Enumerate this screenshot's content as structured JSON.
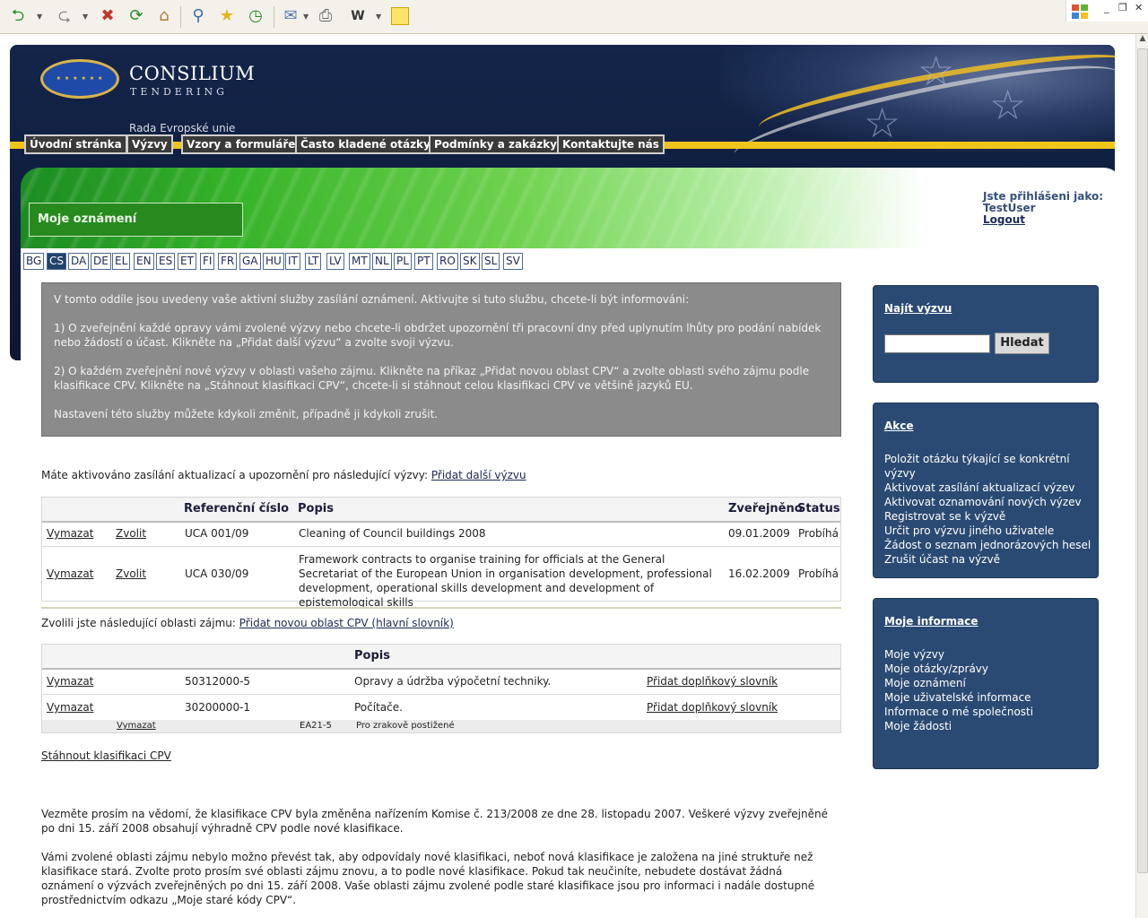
{
  "browser": {
    "toolbar_icons": [
      "back-icon",
      "forward-icon",
      "stop-icon",
      "refresh-icon",
      "home-icon",
      "search-icon",
      "favorites-icon",
      "history-icon",
      "mail-icon",
      "print-icon",
      "word-icon",
      "note-icon"
    ]
  },
  "header": {
    "brand_main": "CONSILIUM",
    "brand_sub": "TENDERING",
    "subtitle": "Rada Evropské unie",
    "nav": [
      "Úvodní stránka",
      "Výzvy",
      "Vzory a formuláře",
      "Často kladené otázky",
      "Podmínky a zakázky",
      "Kontaktujte nás"
    ]
  },
  "banner": {
    "section_title": "Moje oznámení"
  },
  "login": {
    "label": "Jste přihlášeni jako:",
    "user": "TestUser",
    "logout": "Logout"
  },
  "languages": [
    "BG",
    "CS",
    "DA",
    "DE",
    "EL",
    "EN",
    "ES",
    "ET",
    "FI",
    "FR",
    "GA",
    "HU",
    "IT",
    "LT",
    "LV",
    "MT",
    "NL",
    "PL",
    "PT",
    "RO",
    "SK",
    "SL",
    "SV"
  ],
  "active_language": "CS",
  "info": {
    "p1": "V tomto oddíle jsou uvedeny vaše aktivní služby zasílání oznámení. Aktivujte si tuto službu, chcete-li být informováni:",
    "p2": "1) O zveřejnění každé opravy vámi zvolené výzvy nebo chcete-li obdržet upozornění tři pracovní dny před uplynutím lhůty pro podání nabídek nebo žádostí o účast. Klikněte na „Přidat další výzvu“ a zvolte svoji výzvu.",
    "p3": "2) O každém zveřejnění nové výzvy v oblasti vašeho zájmu. Klikněte na příkaz „Přidat novou oblast CPV“ a zvolte oblasti svého zájmu podle klasifikace CPV. Klikněte na „Stáhnout klasifikaci CPV“, chcete-li si stáhnout celou klasifikaci CPV ve většině jazyků EU.",
    "p4": "Nastavení této služby můžete kdykoli změnit, případně ji kdykoli zrušit."
  },
  "calls": {
    "intro": "Máte aktivováno zasílání aktualizací a upozornění pro následující výzvy:",
    "add_link": "Přidat další výzvu",
    "headers": {
      "ref": "Referenční číslo",
      "desc": "Popis",
      "published": "Zveřejněno",
      "status": "Status"
    },
    "rows": [
      {
        "delete": "Vymazat",
        "select": "Zvolit",
        "ref": "UCA 001/09",
        "desc": "Cleaning of Council buildings 2008",
        "published": "09.01.2009",
        "status": "Probíhá"
      },
      {
        "delete": "Vymazat",
        "select": "Zvolit",
        "ref": "UCA 030/09",
        "desc": "Framework contracts to organise training for officials at the General Secretariat of the European Union in organisation development, professional development, operational skills development and development of epistemological skills",
        "published": "16.02.2009",
        "status": "Probíhá"
      }
    ]
  },
  "cpv": {
    "intro": "Zvolili jste následující oblasti zájmu:",
    "add_link": "Přidat novou oblast CPV (hlavní slovník)",
    "header_desc": "Popis",
    "rows": [
      {
        "delete": "Vymazat",
        "code": "50312000-5",
        "desc": "Opravy a údržba výpočetní techniky.",
        "add": "Přidat doplňkový slovník"
      },
      {
        "delete": "Vymazat",
        "code": "30200000-1",
        "desc": "Počítače.",
        "add": "Přidat doplňkový slovník"
      }
    ],
    "sub_row": {
      "delete": "Vymazat",
      "code": "EA21-5",
      "desc": "Pro zrakově postižené"
    },
    "download": "Stáhnout klasifikaci CPV"
  },
  "notes": {
    "n1": "Vezměte prosím na vědomí, že klasifikace CPV byla změněna nařízením Komise č. 213/2008 ze dne 28. listopadu 2007. Veškeré výzvy zveřejněné po dni 15. září 2008 obsahují výhradně CPV podle nové klasifikace.",
    "n2": "Vámi zvolené oblasti zájmu nebylo možno převést tak, aby odpovídaly nové klasifikaci, neboť nová klasifikace je založena na jiné struktuře než klasifikace stará. Zvolte proto prosím své oblasti zájmu znovu, a to podle nové klasifikace. Pokud tak neučiníte, nebudete dostávat žádná oznámení o výzvách zveřejněných po dni 15. září 2008. Vaše oblasti zájmu zvolené podle staré klasifikace jsou pro informaci i nadále dostupné prostřednictvím odkazu „Moje staré kódy CPV“."
  },
  "sidebar": {
    "search": {
      "title": "Najít výzvu",
      "button": "Hledat",
      "value": ""
    },
    "actions": {
      "title": "Akce",
      "items": [
        "Položit otázku týkající se konkrétní výzvy",
        "Aktivovat zasílání aktualizací výzev",
        "Aktivovat oznamování nových výzev",
        "Registrovat se k výzvě",
        "Určit pro výzvu jiného uživatele",
        "Žádost o seznam jednorázových hesel",
        "Zrušit účast na  výzvě"
      ]
    },
    "myinfo": {
      "title": "Moje informace",
      "items": [
        "Moje výzvy",
        "Moje otázky/zprávy",
        "Moje oznámení",
        "Moje uživatelské informace",
        "Informace o mé společnosti",
        "Moje žádosti"
      ]
    }
  },
  "colors": {
    "navy": "#2b4a73",
    "gold": "#f0c51a",
    "green": "#278a1f",
    "info_gray": "#8b8b8b"
  }
}
